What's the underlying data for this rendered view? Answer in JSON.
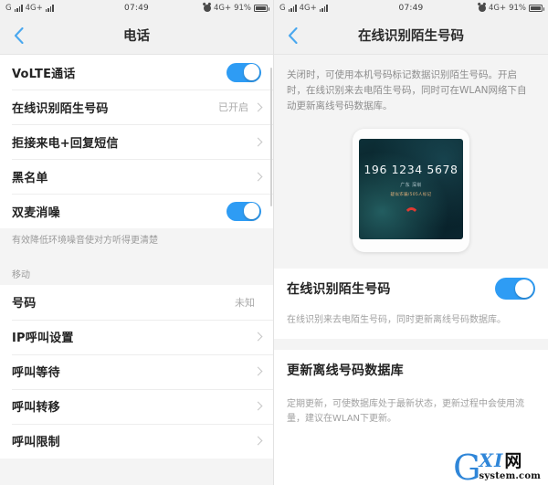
{
  "status_bar": {
    "sim1_network": "G",
    "sim2_network": "4G+",
    "time": "07:49",
    "network_right": "4G+",
    "battery_percent": "91%",
    "alarm_icon": "alarm-clock-icon"
  },
  "left_screen": {
    "nav": {
      "back_icon": "chevron-left-icon",
      "title": "电话"
    },
    "group_a": [
      {
        "label": "VoLTE通话",
        "type": "toggle",
        "on": true
      },
      {
        "label": "在线识别陌生号码",
        "type": "link",
        "value": "已开启"
      },
      {
        "label": "拒接来电+回复短信",
        "type": "link",
        "value": ""
      },
      {
        "label": "黑名单",
        "type": "link",
        "value": ""
      },
      {
        "label": "双麦消噪",
        "type": "toggle",
        "on": true
      }
    ],
    "footer_note": "有效降低环境噪音使对方听得更清楚",
    "section_title": "移动",
    "group_b": [
      {
        "label": "号码",
        "type": "value",
        "value": "未知"
      },
      {
        "label": "IP呼叫设置",
        "type": "link",
        "value": ""
      },
      {
        "label": "呼叫等待",
        "type": "link",
        "value": ""
      },
      {
        "label": "呼叫转移",
        "type": "link",
        "value": ""
      },
      {
        "label": "呼叫限制",
        "type": "link",
        "value": ""
      }
    ]
  },
  "right_screen": {
    "nav": {
      "back_icon": "chevron-left-icon",
      "title": "在线识别陌生号码"
    },
    "description": "关闭时，可使用本机号码标记数据识别陌生号码。开启时，在线识别来去电陌生号码，同时可在WLAN网络下自动更新离线号码数据库。",
    "preview": {
      "number": "196 1234 5678",
      "location": "广东 深圳",
      "tag": "疑似诈骗/505人标记",
      "hangup_icon": "hangup-phone-icon"
    },
    "toggle_row": {
      "label": "在线识别陌生号码",
      "on": true
    },
    "toggle_note": "在线识别来去电陌生号码，同时更新离线号码数据库。",
    "update_row": {
      "label": "更新离线号码数据库"
    },
    "update_note": "定期更新，可使数据库处于最新状态，更新过程中会使用流量，建议在WLAN下更新。"
  },
  "watermark": {
    "letter": "G",
    "mid": "XI",
    "cn": "网",
    "sub": "system.com"
  },
  "colors": {
    "accent": "#2e9cf4",
    "back_arrow": "#4aa8ef",
    "header_bg": "#f1f1f1",
    "page_bg": "#f4f4f4",
    "hangup": "#e03a32"
  }
}
